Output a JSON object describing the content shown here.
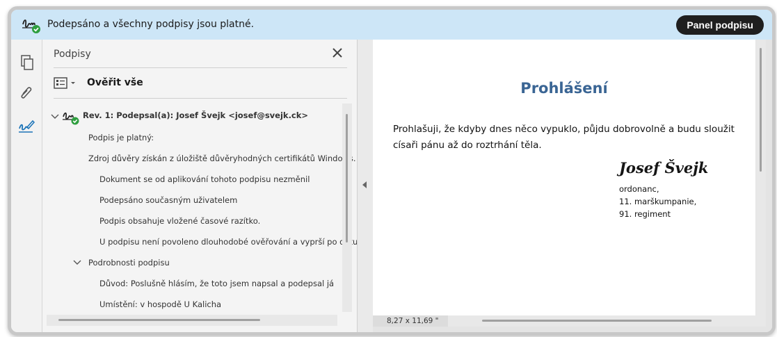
{
  "banner": {
    "message": "Podepsáno a všechny podpisy jsou platné.",
    "panel_button": "Panel podpisu",
    "icon": "signature-valid-icon"
  },
  "toolrail": {
    "icons": [
      "pages-icon",
      "attachment-icon",
      "signature-pen-icon"
    ]
  },
  "signatures_panel": {
    "title": "Podpisy",
    "verify_all": "Ověřit vše",
    "revision": "Rev. 1: Podepsal(a): Josef Švejk <josef@svejk.ck>",
    "valid": "Podpis je platný:",
    "trust_source": "Zdroj důvěry získán z úložiště důvěryhodných certifikátů Windows.",
    "details": [
      "Dokument se od aplikování tohoto podpisu nezměnil",
      "Podepsáno současným uživatelem",
      "Podpis obsahuje vložené časové razítko.",
      "U podpisu není povoleno dlouhodobé ověřování a vyprší po datu ..."
    ],
    "signature_details_label": "Podrobnosti podpisu",
    "signature_details": [
      "Důvod: Poslušně hlásím, že toto jsem napsal a podepsal já",
      "Umístění: v hospodě U Kalicha"
    ]
  },
  "document": {
    "title": "Prohlášení",
    "body": "Prohlašuji, že kdyby dnes něco vypuklo, půjdu dobrovolně a budu sloužit císaři pánu až do roztrhání těla.",
    "signature": "Josef Švejk",
    "rank_lines": [
      "ordonanc,",
      "11. marškumpanie,",
      "91. regiment"
    ],
    "page_size": "8,27 x 11,69 \""
  },
  "colors": {
    "banner_bg": "#cde6f7",
    "title_blue": "#3a6594",
    "valid_green": "#2e9e3f",
    "accent_blue": "#1a73b8"
  }
}
